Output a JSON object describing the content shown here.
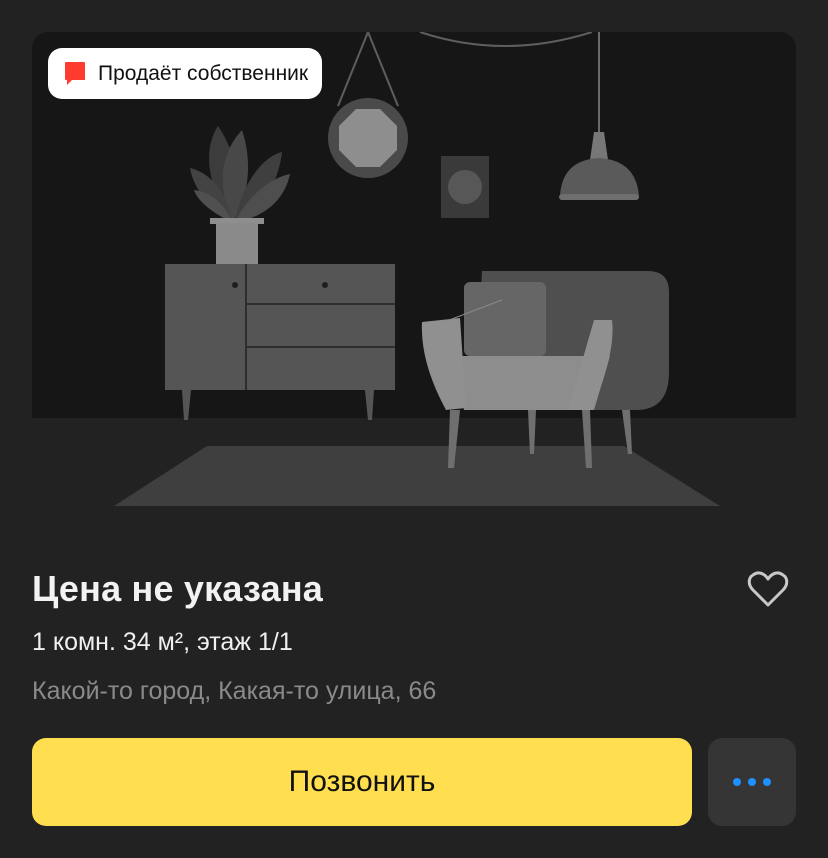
{
  "listing": {
    "owner_badge_label": "Продаёт собственник",
    "price": "Цена не указана",
    "details": "1 комн. 34 м², этаж 1/1",
    "address": "Какой-то город, Какая-то улица, 66"
  },
  "actions": {
    "call_label": "Позвонить",
    "more_icon": "more-dots-icon",
    "favorite_icon": "heart-outline-icon"
  },
  "colors": {
    "background": "#222222",
    "call_button": "#ffdf4f",
    "badge_icon": "#ff3b30",
    "more_dots": "#1e90ff"
  }
}
